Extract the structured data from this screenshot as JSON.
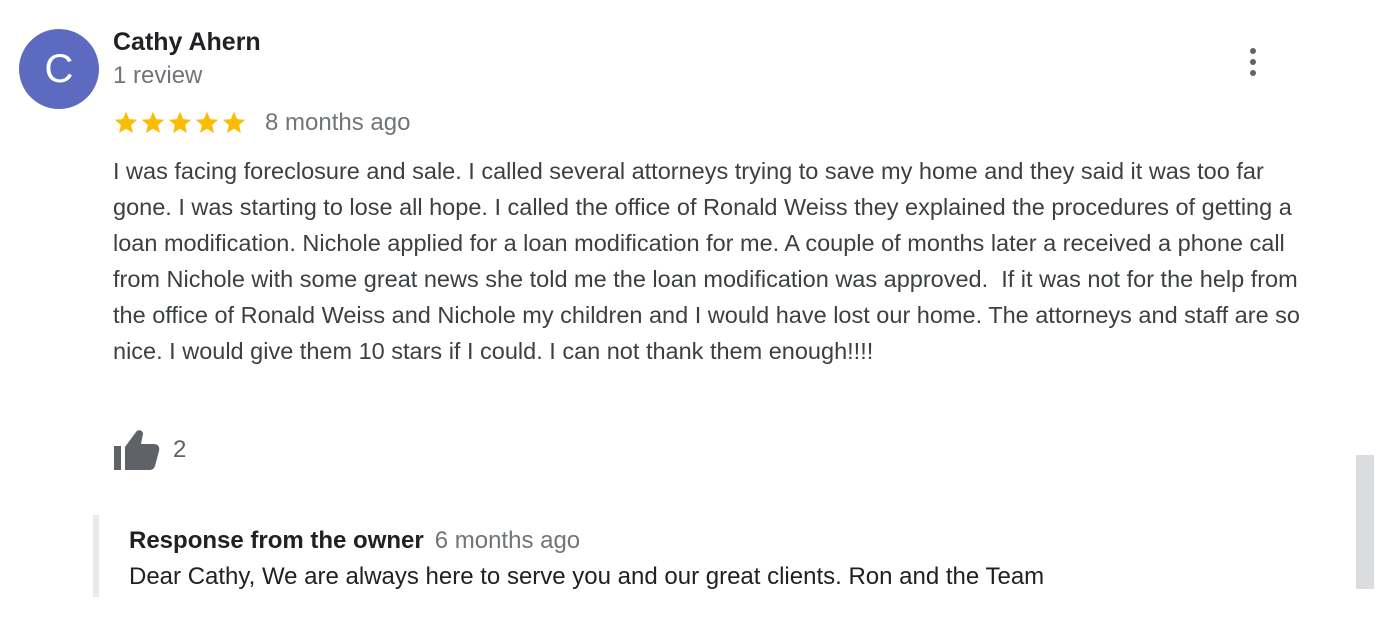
{
  "review": {
    "avatar_letter": "C",
    "avatar_color": "#5c6bc0",
    "author_name": "Cathy Ahern",
    "review_count": "1 review",
    "rating": 5,
    "rating_max": 5,
    "star_color": "#fbbc04",
    "time_ago": "8 months ago",
    "text": "I was facing foreclosure and sale. I called several attorneys trying to save my home and they said it was too far gone. I was starting to lose all hope. I called the office of Ronald Weiss they explained the procedures of getting a  loan modification. Nichole applied for a loan modification for me. A couple of months later a received a phone call from Nichole with some great news she told me the loan modification was approved.  If it was not for the help from the office of Ronald Weiss and Nichole my children and I would have lost our home. The attorneys and staff are so nice. I would give them 10 stars if I could. I can not thank them enough!!!!",
    "like_count": "2",
    "like_icon": "thumbs-up-icon",
    "more_icon": "more-vert-icon"
  },
  "owner_response": {
    "title": "Response from the owner",
    "time_ago": "6 months ago",
    "text": "Dear Cathy, We are always here to serve you and our great clients. Ron and the Team"
  }
}
